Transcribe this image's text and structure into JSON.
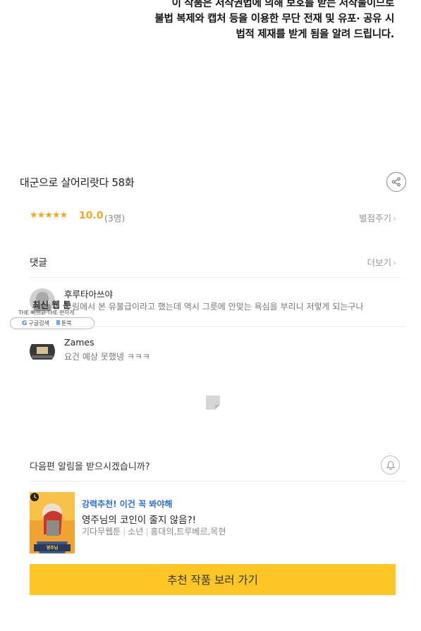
{
  "notice": {
    "line1": "이 작품은 저작권법에 의해 보호를 받는 저작물이므로",
    "line2": "불법 복제와 캡처 등을 이용한 무단 전재 및 유포· 공유 시",
    "line3": "법적 제재를 받게 됨을 알려 드립니다."
  },
  "episode": {
    "title": "대군으로 살어리랏다 58화",
    "share_icon": "share-icon"
  },
  "rating": {
    "stars": "★★★★★",
    "score": "10.0",
    "count": "(3명)",
    "rate_link": "별점주기",
    "chevron": "›"
  },
  "comments": {
    "title": "댓글",
    "more_link": "더보기",
    "chevron": "›",
    "items": [
      {
        "author": "후루타아쓰야",
        "body": "무림에서 본 유불급이라고 했는데 역시 그릇에 안맞는 욕심을 부리니 저렇게 되는구나",
        "avatar": "avatar-logo"
      },
      {
        "author": "Zames",
        "body": "요건 예상 못했넹 ㅋㅋㅋ",
        "avatar": "avatar-photo"
      }
    ]
  },
  "watermark": {
    "line1": "최신 웹 툰",
    "line2": "THE 빠르고 THE 편하게",
    "search_label": "구글검색",
    "site_label": "툰북"
  },
  "notify": {
    "text": "다음편 알림을 받으시겠습니까?",
    "icon": "bell-icon"
  },
  "recommend": {
    "tag": "강력추천! 이건 꼭 봐야해",
    "title": "영주님의 코인이 줄지 않음?!",
    "meta": [
      "기다무웹툰",
      "소년",
      "홍대의,트루베르,목현"
    ],
    "cta": "추천 작품 보러 가기"
  },
  "colors": {
    "accent": "#fcc627",
    "star": "#f5a623",
    "link_blue": "#2b6fd6"
  }
}
